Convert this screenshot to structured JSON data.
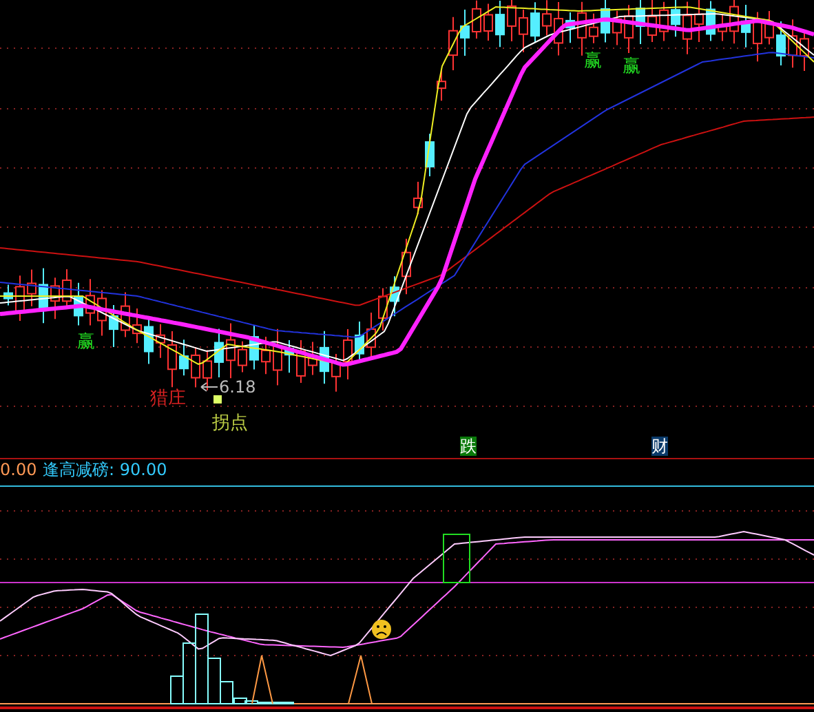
{
  "main_chart": {
    "labels": [
      {
        "text": "赢",
        "color": "#22dd22"
      },
      {
        "text": "赢",
        "color": "#22dd22"
      },
      {
        "text": "赢",
        "color": "#22dd22"
      },
      {
        "text": "猎庄",
        "color": "#dd2222"
      },
      {
        "text": "拐点",
        "color": "#bbcc44"
      }
    ],
    "low_price": "6.18"
  },
  "markers": [
    {
      "text": "跌",
      "color": "#0a7a0a"
    },
    {
      "text": "财",
      "color": "#0a3a6a"
    }
  ],
  "indicator_panel": {
    "value_prefix": "0.00",
    "legend": "逢高减磅: 90.00"
  }
}
